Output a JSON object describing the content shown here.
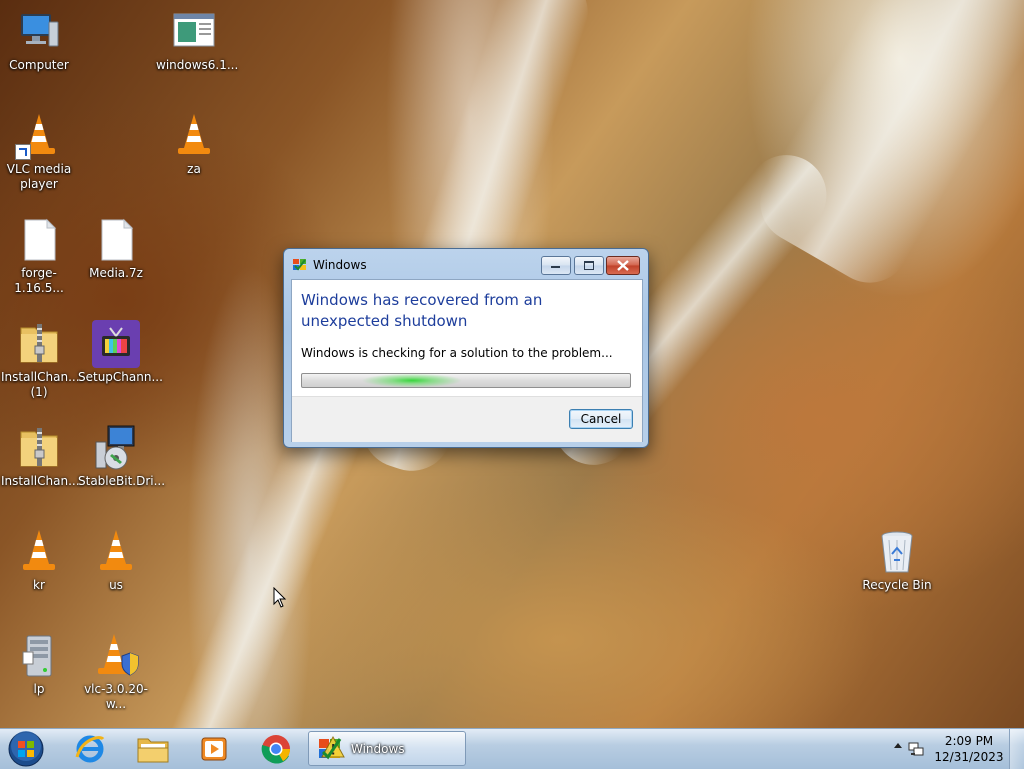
{
  "desktop_icons": [
    {
      "name": "desktop-icon-computer",
      "icon": "computer-icon",
      "label": "Computer"
    },
    {
      "name": "desktop-icon-windows61",
      "icon": "document-window-icon",
      "label": "windows6.1..."
    },
    {
      "name": "desktop-icon-vlc",
      "icon": "vlc-cone-icon",
      "label": "VLC media player"
    },
    {
      "name": "desktop-icon-za",
      "icon": "vlc-cone-icon",
      "label": "za"
    },
    {
      "name": "desktop-icon-forge",
      "icon": "blank-file-icon",
      "label": "forge-1.16.5..."
    },
    {
      "name": "desktop-icon-media7z",
      "icon": "blank-file-icon",
      "label": "Media.7z"
    },
    {
      "name": "desktop-icon-installchan1",
      "icon": "zip-folder-icon",
      "label": "InstallChan... (1)"
    },
    {
      "name": "desktop-icon-setupchann",
      "icon": "tv-installer-icon",
      "label": "SetupChann..."
    },
    {
      "name": "desktop-icon-installchan",
      "icon": "zip-folder-icon",
      "label": "InstallChan..."
    },
    {
      "name": "desktop-icon-stablebit",
      "icon": "driver-installer-icon",
      "label": "StableBit.Dri..."
    },
    {
      "name": "desktop-icon-kr",
      "icon": "vlc-cone-icon",
      "label": "kr"
    },
    {
      "name": "desktop-icon-us",
      "icon": "vlc-cone-icon",
      "label": "us"
    },
    {
      "name": "desktop-icon-lp",
      "icon": "server-icon",
      "label": "lp"
    },
    {
      "name": "desktop-icon-vlc-installer",
      "icon": "vlc-installer-icon",
      "label": "vlc-3.0.20-w..."
    },
    {
      "name": "desktop-icon-recycle-bin",
      "icon": "recycle-bin-icon",
      "label": "Recycle Bin"
    }
  ],
  "dialog": {
    "title": "Windows",
    "heading": "Windows has recovered from an unexpected shutdown",
    "message": "Windows is checking for a solution to the problem...",
    "progress_state": "indeterminate",
    "cancel_label": "Cancel",
    "controls": [
      "minimize-icon",
      "restore-icon",
      "close-icon"
    ]
  },
  "taskbar": {
    "start": "windows-start-orb-icon",
    "pinned": [
      "internet-explorer-icon",
      "file-explorer-icon",
      "media-player-icon",
      "chrome-icon"
    ],
    "active_window_label": "Windows",
    "tray_icons": [
      "show-hidden-icons-chevron",
      "network-icon"
    ],
    "clock_time": "2:09 PM",
    "clock_date": "12/31/2023"
  },
  "colors": {
    "heading_blue": "#1e3e9c",
    "progress_green": "#37d63c",
    "vlc_orange": "#f28a0f"
  }
}
